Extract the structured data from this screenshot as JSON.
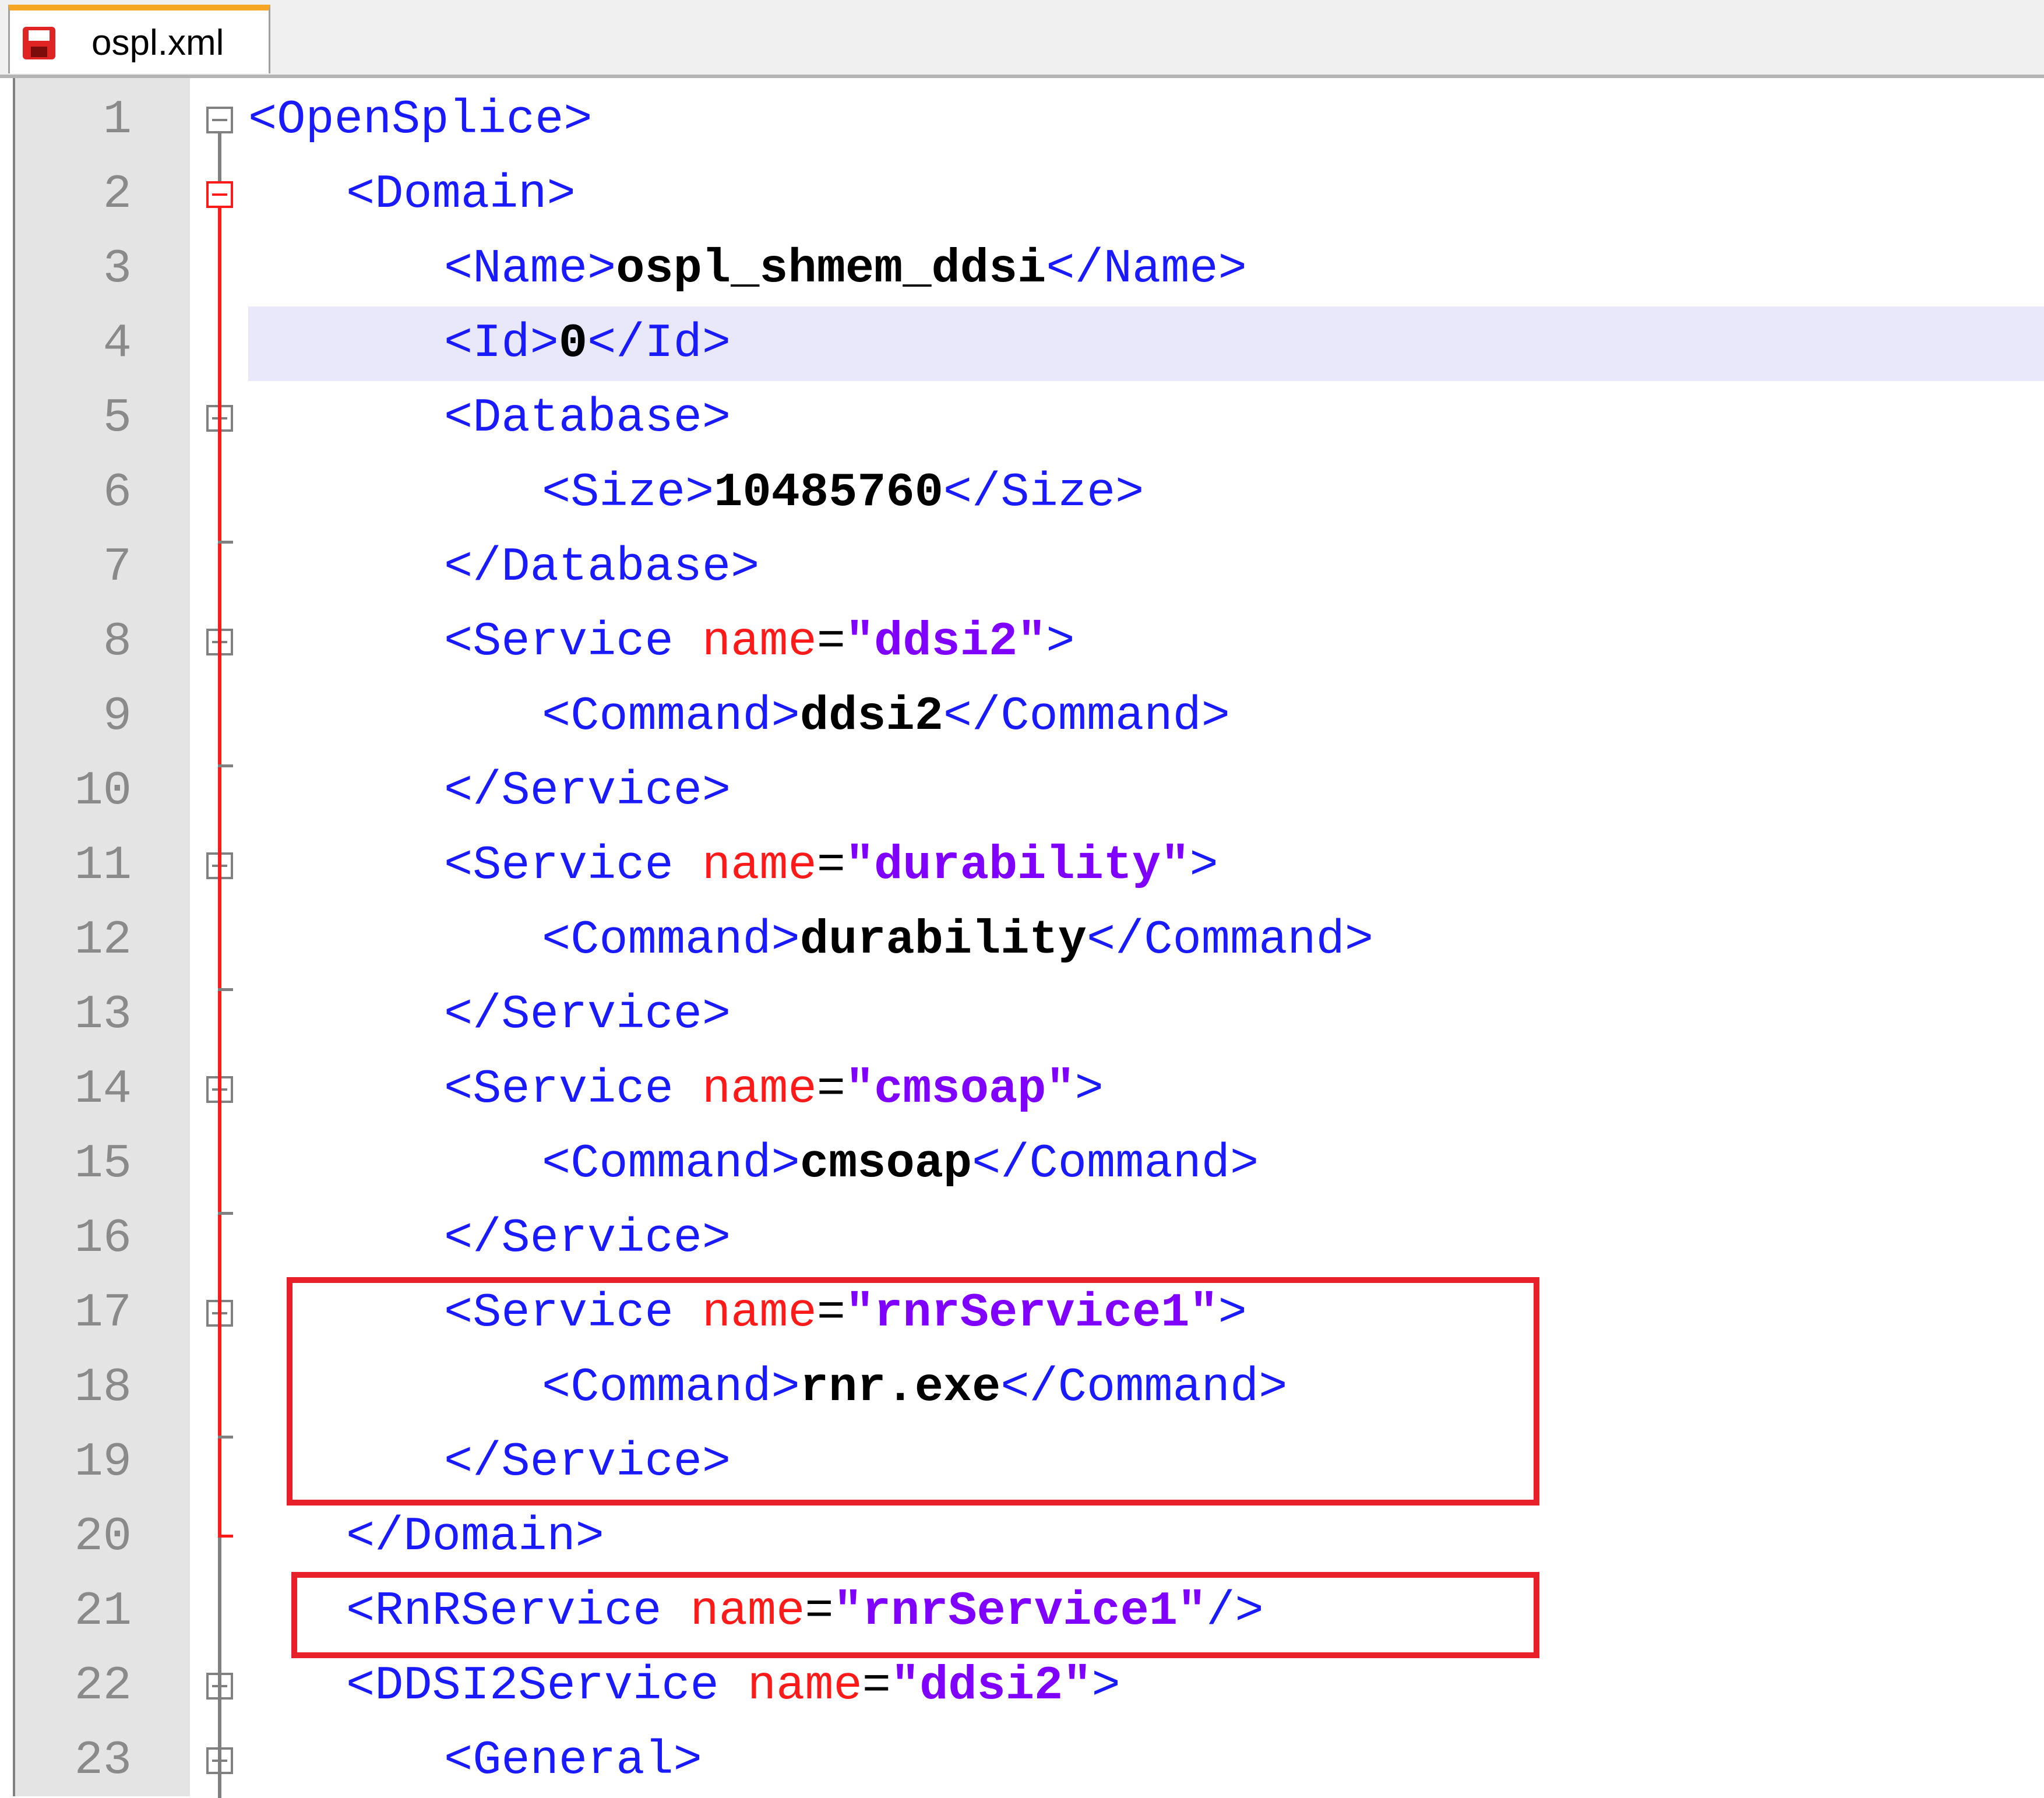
{
  "tab": {
    "filename": "ospl.xml"
  },
  "lines": [
    {
      "num": "1",
      "parts": [
        [
          "tag",
          "<OpenSplice>"
        ]
      ]
    },
    {
      "num": "2",
      "parts": [
        [
          "tag",
          "<Domain>"
        ]
      ]
    },
    {
      "num": "3",
      "parts": [
        [
          "tag",
          "<Name>"
        ],
        [
          "txt",
          "ospl_shmem_ddsi"
        ],
        [
          "tag",
          "</Name>"
        ]
      ]
    },
    {
      "num": "4",
      "parts": [
        [
          "tag",
          "<Id>"
        ],
        [
          "txt",
          "0"
        ],
        [
          "tag",
          "</Id>"
        ]
      ]
    },
    {
      "num": "5",
      "parts": [
        [
          "tag",
          "<Database>"
        ]
      ]
    },
    {
      "num": "6",
      "parts": [
        [
          "tag",
          "<Size>"
        ],
        [
          "txt",
          "10485760"
        ],
        [
          "tag",
          "</Size>"
        ]
      ]
    },
    {
      "num": "7",
      "parts": [
        [
          "tag",
          "</Database>"
        ]
      ]
    },
    {
      "num": "8",
      "parts": [
        [
          "tag",
          "<Service "
        ],
        [
          "attr",
          "name"
        ],
        [
          "eq",
          "="
        ],
        [
          "val",
          "\"ddsi2\""
        ],
        [
          "tag",
          ">"
        ]
      ]
    },
    {
      "num": "9",
      "parts": [
        [
          "tag",
          "<Command>"
        ],
        [
          "txt",
          "ddsi2"
        ],
        [
          "tag",
          "</Command>"
        ]
      ]
    },
    {
      "num": "10",
      "parts": [
        [
          "tag",
          "</Service>"
        ]
      ]
    },
    {
      "num": "11",
      "parts": [
        [
          "tag",
          "<Service "
        ],
        [
          "attr",
          "name"
        ],
        [
          "eq",
          "="
        ],
        [
          "val",
          "\"durability\""
        ],
        [
          "tag",
          ">"
        ]
      ]
    },
    {
      "num": "12",
      "parts": [
        [
          "tag",
          "<Command>"
        ],
        [
          "txt",
          "durability"
        ],
        [
          "tag",
          "</Command>"
        ]
      ]
    },
    {
      "num": "13",
      "parts": [
        [
          "tag",
          "</Service>"
        ]
      ]
    },
    {
      "num": "14",
      "parts": [
        [
          "tag",
          "<Service "
        ],
        [
          "attr",
          "name"
        ],
        [
          "eq",
          "="
        ],
        [
          "val",
          "\"cmsoap\""
        ],
        [
          "tag",
          ">"
        ]
      ]
    },
    {
      "num": "15",
      "parts": [
        [
          "tag",
          "<Command>"
        ],
        [
          "txt",
          "cmsoap"
        ],
        [
          "tag",
          "</Command>"
        ]
      ]
    },
    {
      "num": "16",
      "parts": [
        [
          "tag",
          "</Service>"
        ]
      ]
    },
    {
      "num": "17",
      "parts": [
        [
          "tag",
          "<Service "
        ],
        [
          "attr",
          "name"
        ],
        [
          "eq",
          "="
        ],
        [
          "val",
          "\"rnrService1\""
        ],
        [
          "tag",
          ">"
        ]
      ]
    },
    {
      "num": "18",
      "parts": [
        [
          "tag",
          "<Command>"
        ],
        [
          "txt",
          "rnr.exe"
        ],
        [
          "tag",
          "</Command>"
        ]
      ]
    },
    {
      "num": "19",
      "parts": [
        [
          "tag",
          "</Service>"
        ]
      ]
    },
    {
      "num": "20",
      "parts": [
        [
          "tag",
          "</Domain>"
        ]
      ]
    },
    {
      "num": "21",
      "parts": [
        [
          "tag",
          "<RnRService "
        ],
        [
          "attr",
          "name"
        ],
        [
          "eq",
          "="
        ],
        [
          "val",
          "\"rnrService1\""
        ],
        [
          "tag",
          "/>"
        ]
      ]
    },
    {
      "num": "22",
      "parts": [
        [
          "tag",
          "<DDSI2Service "
        ],
        [
          "attr",
          "name"
        ],
        [
          "eq",
          "="
        ],
        [
          "val",
          "\"ddsi2\""
        ],
        [
          "tag",
          ">"
        ]
      ]
    },
    {
      "num": "23",
      "parts": [
        [
          "tag",
          "<General>"
        ]
      ]
    }
  ],
  "colors": {
    "tag": "#1a1aff",
    "attribute": "#ff1a1a",
    "value": "#8000ff",
    "text": "#000000",
    "highlight_box": "#e8202a",
    "fold_active": "#ff1a1a"
  }
}
